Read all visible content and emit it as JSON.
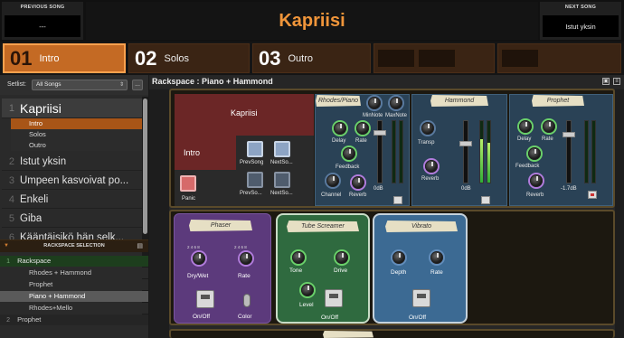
{
  "header": {
    "prev_caption": "PREVIOUS SONG",
    "prev_value": "---",
    "title": "Kapriisi",
    "next_caption": "NEXT SONG",
    "next_value": "Istut yksin"
  },
  "parts": [
    {
      "num": "01",
      "label": "Intro"
    },
    {
      "num": "02",
      "label": "Solos"
    },
    {
      "num": "03",
      "label": "Outro"
    }
  ],
  "setlist": {
    "label": "Setlist:",
    "value": "All Songs",
    "more": "..."
  },
  "songs": [
    {
      "num": "1",
      "title": "Kapriisi"
    },
    {
      "num": "2",
      "title": "Istut yksin"
    },
    {
      "num": "3",
      "title": "Umpeen kasvoivat po..."
    },
    {
      "num": "4",
      "title": "Enkeli"
    },
    {
      "num": "5",
      "title": "Giba"
    },
    {
      "num": "6",
      "title": "Kääntäisikö hän selk..."
    }
  ],
  "current_song_parts": [
    "Intro",
    "Solos",
    "Outro"
  ],
  "rack_selection": {
    "title": "RACKSPACE SELECTION",
    "groups": [
      {
        "num": "1",
        "name": "Rackspace"
      },
      {
        "num": "2",
        "name": "Prophet"
      }
    ],
    "variations": [
      "Rhodes + Hammond",
      "Prophet",
      "Piano + Hammond",
      "Rhodes+Mello"
    ]
  },
  "rackspace": {
    "title": "Rackspace : Piano + Hammond"
  },
  "song_panel": {
    "song": "Kapriisi",
    "part": "Intro",
    "panic": "Panic",
    "prev_song": "PrevSong",
    "next_song": "NextSo...",
    "prev_part": "PrevSo...",
    "next_part": "NextSo..."
  },
  "rhodes": {
    "tape": "Rhodes/Piano",
    "min_note": "MinNote",
    "max_note": "MaxNote",
    "delay": "Delay",
    "rate": "Rate",
    "feedback": "Feedback",
    "channel": "Channel",
    "reverb": "Reverb",
    "db": "0dB"
  },
  "hammond": {
    "tape": "Hammond",
    "transp": "Transp",
    "reverb": "Reverb",
    "db": "0dB"
  },
  "prophet": {
    "tape": "Prophet",
    "delay": "Delay",
    "rate": "Rate",
    "feedback": "Feedback",
    "reverb": "Reverb",
    "db": "-1.7dB"
  },
  "phaser": {
    "tape": "Phaser",
    "drywet": "Dry/Wet",
    "rate": "Rate",
    "onoff": "On/Off",
    "color": "Color"
  },
  "tube": {
    "tape": "Tube Screamer",
    "tone": "Tone",
    "drive": "Drive",
    "level": "Level",
    "onoff": "On/Off"
  },
  "vibrato": {
    "tape": "Vibrato",
    "depth": "Depth",
    "rate": "Rate",
    "onoff": "On/Off"
  },
  "colors": {
    "accent": "#c46a24",
    "title": "#f0953a",
    "phaser": "#5c3a7c",
    "tube": "#2f6a3f",
    "vibrato": "#3c6a93"
  }
}
